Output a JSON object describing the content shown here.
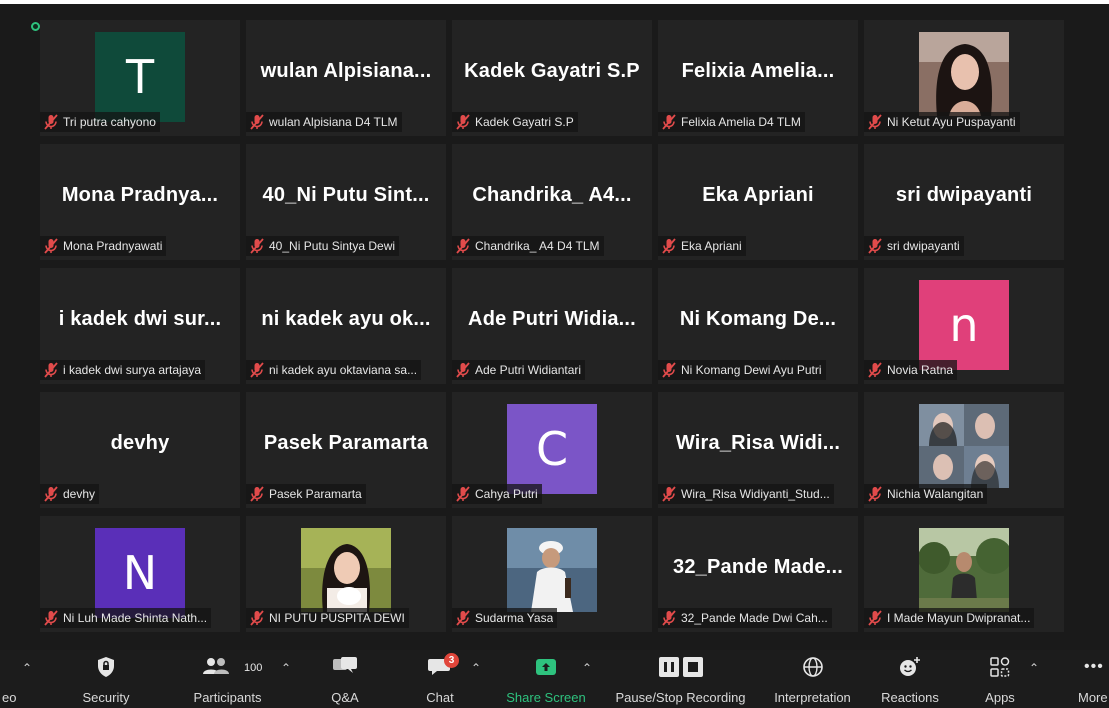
{
  "tiles": [
    {
      "name": "Tri putra cahyono",
      "avatar": {
        "letter": "T",
        "color": "#0f4a3a"
      }
    },
    {
      "name": "wulan Alpisiana D4 TLM",
      "title": "wulan Alpisiana..."
    },
    {
      "name": "Kadek Gayatri S.P",
      "title": "Kadek Gayatri S.P"
    },
    {
      "name": "Felixia Amelia D4 TLM",
      "title": "Felixia Amelia..."
    },
    {
      "name": "Ni Ketut Ayu Puspayanti",
      "photo": "woman-long-hair"
    },
    {
      "name": "Mona Pradnyawati",
      "title": "Mona Pradnya..."
    },
    {
      "name": "40_Ni Putu Sintya Dewi",
      "title": "40_Ni Putu Sint..."
    },
    {
      "name": "Chandrika_ A4 D4 TLM",
      "title": "Chandrika_ A4..."
    },
    {
      "name": "Eka Apriani",
      "title": "Eka Apriani"
    },
    {
      "name": "sri dwipayanti",
      "title": "sri dwipayanti"
    },
    {
      "name": "i kadek dwi surya artajaya",
      "title": "i kadek dwi sur..."
    },
    {
      "name": "ni kadek ayu oktaviana sa...",
      "title": "ni kadek ayu ok..."
    },
    {
      "name": "Ade Putri Widiantari",
      "title": "Ade Putri Widia..."
    },
    {
      "name": "Ni Komang Dewi Ayu Putri",
      "title": "Ni Komang De..."
    },
    {
      "name": "Novia Ratna",
      "avatar": {
        "letter": "n",
        "color": "#e0407a"
      }
    },
    {
      "name": "devhy",
      "title": "devhy"
    },
    {
      "name": "Pasek Paramarta",
      "title": "Pasek Paramarta"
    },
    {
      "name": "Cahya Putri",
      "avatar": {
        "letter": "C",
        "color": "#7b55c7"
      }
    },
    {
      "name": "Wira_Risa Widiyanti_Stud...",
      "title": "Wira_Risa Widi..."
    },
    {
      "name": "Nichia Walangitan",
      "photo": "collage"
    },
    {
      "name": "Ni Luh Made Shinta Nath...",
      "avatar": {
        "letter": "N",
        "color": "#5a2fb8"
      }
    },
    {
      "name": "NI PUTU PUSPITA DEWI",
      "photo": "girl-with-cat"
    },
    {
      "name": "Sudarma Yasa",
      "photo": "man-white-outfit"
    },
    {
      "name": "32_Pande Made Dwi Cah...",
      "title": "32_Pande Made..."
    },
    {
      "name": "I Made Mayun Dwipranat...",
      "photo": "man-outdoors"
    }
  ],
  "toolbar": {
    "video_fragment": "eo",
    "security": "Security",
    "participants": "Participants",
    "participants_count": "100",
    "qa": "Q&A",
    "chat": "Chat",
    "chat_badge": "3",
    "share_screen": "Share Screen",
    "recording": "Pause/Stop Recording",
    "interpretation": "Interpretation",
    "reactions": "Reactions",
    "apps": "Apps",
    "more": "More",
    "share_color": "#2ec27e"
  }
}
